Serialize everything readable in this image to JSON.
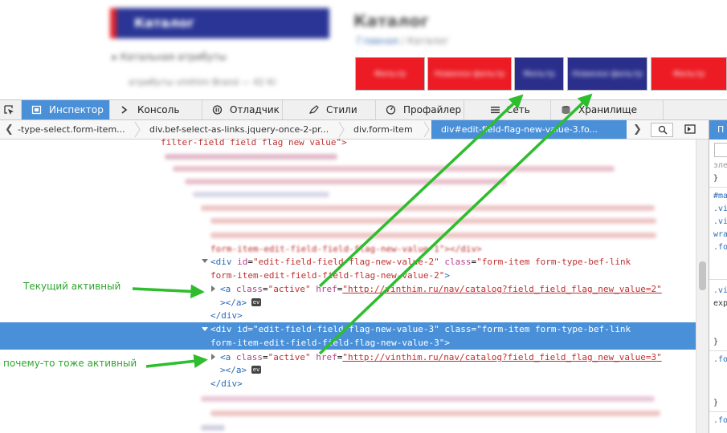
{
  "site": {
    "header_text": "Каталог",
    "catalog_title": "Каталог",
    "catalog_sub_prefix": "Главная",
    "catalog_sub_suffix": "/ Каталог",
    "side_item_1": "▸ Катальная атрибуты",
    "side_item_2": "атрибуты vinthim Brand — 42 Kr",
    "filter_buttons": [
      {
        "label": "Фильтр",
        "color": "#ec1b24"
      },
      {
        "label": "Новинки фильтр",
        "color": "#ec1b24"
      },
      {
        "label": "Фильтр",
        "color": "#2b2f8c"
      },
      {
        "label": "Новинки фильтр",
        "color": "#2b2f8c"
      },
      {
        "label": "Фильтр",
        "color": "#ec1b24"
      }
    ]
  },
  "toolbar": {
    "tabs": [
      {
        "label": "Инспектор",
        "icon": "inspector-icon",
        "active": true
      },
      {
        "label": "Консоль",
        "icon": "console-icon",
        "active": false
      },
      {
        "label": "Отладчик",
        "icon": "debugger-icon",
        "active": false
      },
      {
        "label": "Стили",
        "icon": "style-editor-icon",
        "active": false
      },
      {
        "label": "Профайлер",
        "icon": "profiler-icon",
        "active": false
      },
      {
        "label": "Сеть",
        "icon": "network-icon",
        "active": false
      },
      {
        "label": "Хранилище",
        "icon": "storage-icon",
        "active": false
      }
    ]
  },
  "breadcrumbs": [
    "-type-select.form-item...",
    "div.bef-select-as-links.jquery-once-2-pr...",
    "div.form-item",
    "div#edit-field-flag-new-value-3.fo..."
  ],
  "markup": {
    "line_top": "filter-field field flag new value\">",
    "blur_label": "form-item-edit-field-field-flag-new-value-1\"></div>",
    "div2_open_a": "<div",
    "div2_id_attr": "id",
    "div2_id_val": "\"edit-field-field-flag-new-value-2\"",
    "div2_class_attr": "class",
    "div2_class_val": "\"form-item form-type-bef-link",
    "div2_class_val2": "form-item-edit-field-field-flag-new-value-2\"",
    "div2_close_bracket": ">",
    "a2_open": "<a",
    "a_class_attr": "class",
    "a_class_val": "\"active\"",
    "a_href_attr": "href",
    "a2_href_val": "\"http://vinthim.ru/nav/catalog?field_field_flag_new_value=2\"",
    "a_close": "></a>",
    "div_close": "</div>",
    "div3_line1": "<div id=\"edit-field-field-flag-new-value-3\" class=\"form-item form-type-bef-link",
    "div3_line2": "form-item-edit-field-field-flag-new-value-3\">",
    "a3_href_val": "\"http://vinthim.ru/nav/catalog?field_field_flag_new_value=3\"",
    "ev_badge": "ev"
  },
  "rules_panel": {
    "tab_label": "П",
    "lines": [
      "эле",
      "}",
      "#ma",
      ".vi",
      ".vi",
      "wra",
      ".fo",
      ".vi",
      "exp",
      "}",
      ".fo",
      "}",
      ".fo"
    ]
  },
  "annotations": {
    "current_active": "Текущий активный",
    "also_active": "почему-то тоже активный"
  },
  "colors": {
    "accent": "#4a90d9",
    "arrow": "#2dbd2d",
    "annotation_text": "#2da52d",
    "brand_red": "#ec1b24",
    "brand_blue": "#2b2f8c"
  }
}
